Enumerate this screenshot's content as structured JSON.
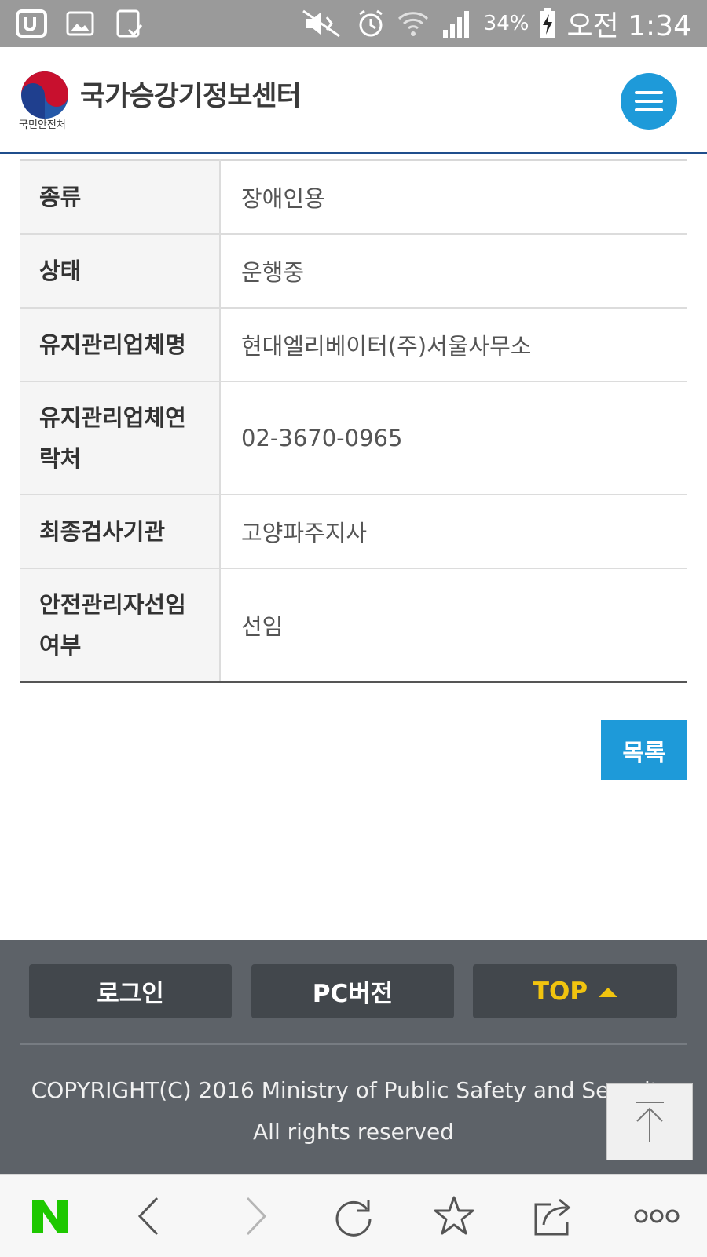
{
  "status_bar": {
    "battery": "34%",
    "clock": "오전 1:34"
  },
  "header": {
    "logo_sub": "국민안전처",
    "site_title": "국가승강기정보센터"
  },
  "details": {
    "rows": [
      {
        "label": "종류",
        "value": "장애인용"
      },
      {
        "label": "상태",
        "value": "운행중"
      },
      {
        "label": "유지관리업체명",
        "value": "현대엘리베이터(주)서울사무소"
      },
      {
        "label": "유지관리업체연락처",
        "value": "02-3670-0965"
      },
      {
        "label": "최종검사기관",
        "value": "고양파주지사"
      },
      {
        "label": "안전관리자선임여부",
        "value": "선임"
      }
    ]
  },
  "list_button": "목록",
  "footer": {
    "login": "로그인",
    "pc_version": "PC버전",
    "top": "TOP",
    "copyright_line1": "COPYRIGHT(C) 2016 Ministry of Public Safety and Security.",
    "copyright_line2": "All rights reserved"
  },
  "browser_bar": {
    "icons": [
      "naver-icon",
      "back-icon",
      "forward-icon",
      "refresh-icon",
      "bookmark-icon",
      "share-icon",
      "more-icon"
    ]
  },
  "colors": {
    "accent": "#1e9ad9",
    "footer_bg": "#5d6268",
    "footer_button": "#42474c",
    "top_text": "#f1c40f",
    "naver_green": "#1ec800"
  }
}
